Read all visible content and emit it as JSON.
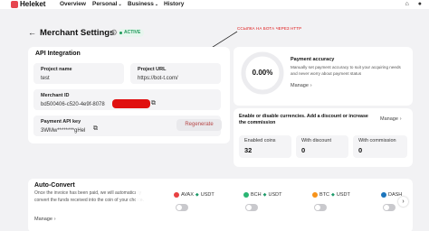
{
  "nav": {
    "logo": "Heleket",
    "items": [
      {
        "label": "Overview",
        "has_menu": false
      },
      {
        "label": "Personal",
        "has_menu": true
      },
      {
        "label": "Business",
        "has_menu": true
      },
      {
        "label": "History",
        "has_menu": false
      }
    ]
  },
  "header": {
    "title": "Merchant Settings",
    "status": "ACTIVE",
    "annotation": "ССЫЛКА НА БОТА ЧЕРЕЗ НТТР"
  },
  "api": {
    "section_title": "API Integration",
    "project_name_label": "Project name",
    "project_name_value": "test",
    "project_url_label": "Project URL",
    "project_url_value": "https://bot-t.com/",
    "merchant_id_label": "Merchant ID",
    "merchant_id_value": "bd500406-c520-4e9f-8078",
    "payment_key_label": "Payment API key",
    "payment_key_value": "3WMw********gHel",
    "regenerate_label": "Regenerate"
  },
  "accuracy": {
    "value": "0.00%",
    "title": "Payment accuracy",
    "description": "Manually set payment accuracy to suit your acquiring needs and never worry about payment status",
    "manage_label": "Manage"
  },
  "currencies": {
    "title": "Enable or disable currencies. Add a discount or increase the commission",
    "manage_label": "Manage",
    "stats": [
      {
        "label": "Enabled coins",
        "value": "32"
      },
      {
        "label": "With discount",
        "value": "0"
      },
      {
        "label": "With commission",
        "value": "0"
      }
    ]
  },
  "auto_convert": {
    "title": "Auto-Convert",
    "description": "Once the invoice has been paid, we will automatically convert the funds received into the coin of your choice.",
    "manage_label": "Manage",
    "pairs": [
      {
        "from": "AVAX",
        "to": "USDT",
        "from_color": "#e84142"
      },
      {
        "from": "BCH",
        "to": "USDT",
        "from_color": "#2ab573"
      },
      {
        "from": "BTC",
        "to": "USDT",
        "from_color": "#f7931a"
      },
      {
        "from": "DASH",
        "to": "",
        "from_color": "#1c75bc"
      }
    ]
  },
  "colors": {
    "accent_red": "#e6454f",
    "active_green": "#1e9a5a",
    "annotation_red": "#e01818"
  }
}
